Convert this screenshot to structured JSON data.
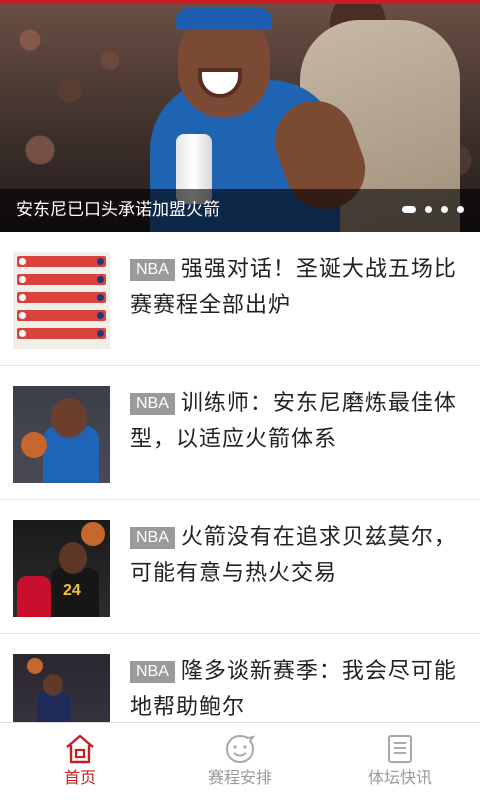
{
  "hero": {
    "caption": "安东尼已口头承诺加盟火箭",
    "slide_count": 4,
    "active_slide": 1
  },
  "news": [
    {
      "tag": "NBA",
      "title": "强强对话！圣诞大战五场比赛赛程全部出炉",
      "thumb_icon": "schedule-graphic"
    },
    {
      "tag": "NBA",
      "title": "训练师：安东尼磨炼最佳体型，以适应火箭体系",
      "thumb_icon": "player-photo"
    },
    {
      "tag": "NBA",
      "title": "火箭没有在追求贝兹莫尔，可能有意与热火交易",
      "thumb_icon": "player-photo",
      "jersey_number": "24"
    },
    {
      "tag": "NBA",
      "title": "隆多谈新赛季：我会尽可能地帮助鲍尔",
      "thumb_icon": "player-photo"
    }
  ],
  "tabbar": {
    "tabs": [
      {
        "label": "首页",
        "icon": "home-icon",
        "active": true
      },
      {
        "label": "赛程安排",
        "icon": "face-icon",
        "active": false
      },
      {
        "label": "体坛快讯",
        "icon": "news-icon",
        "active": false
      }
    ]
  },
  "colors": {
    "accent": "#c81d25",
    "tag_bg": "#9a9a9a",
    "inactive": "#9a9a9a"
  }
}
